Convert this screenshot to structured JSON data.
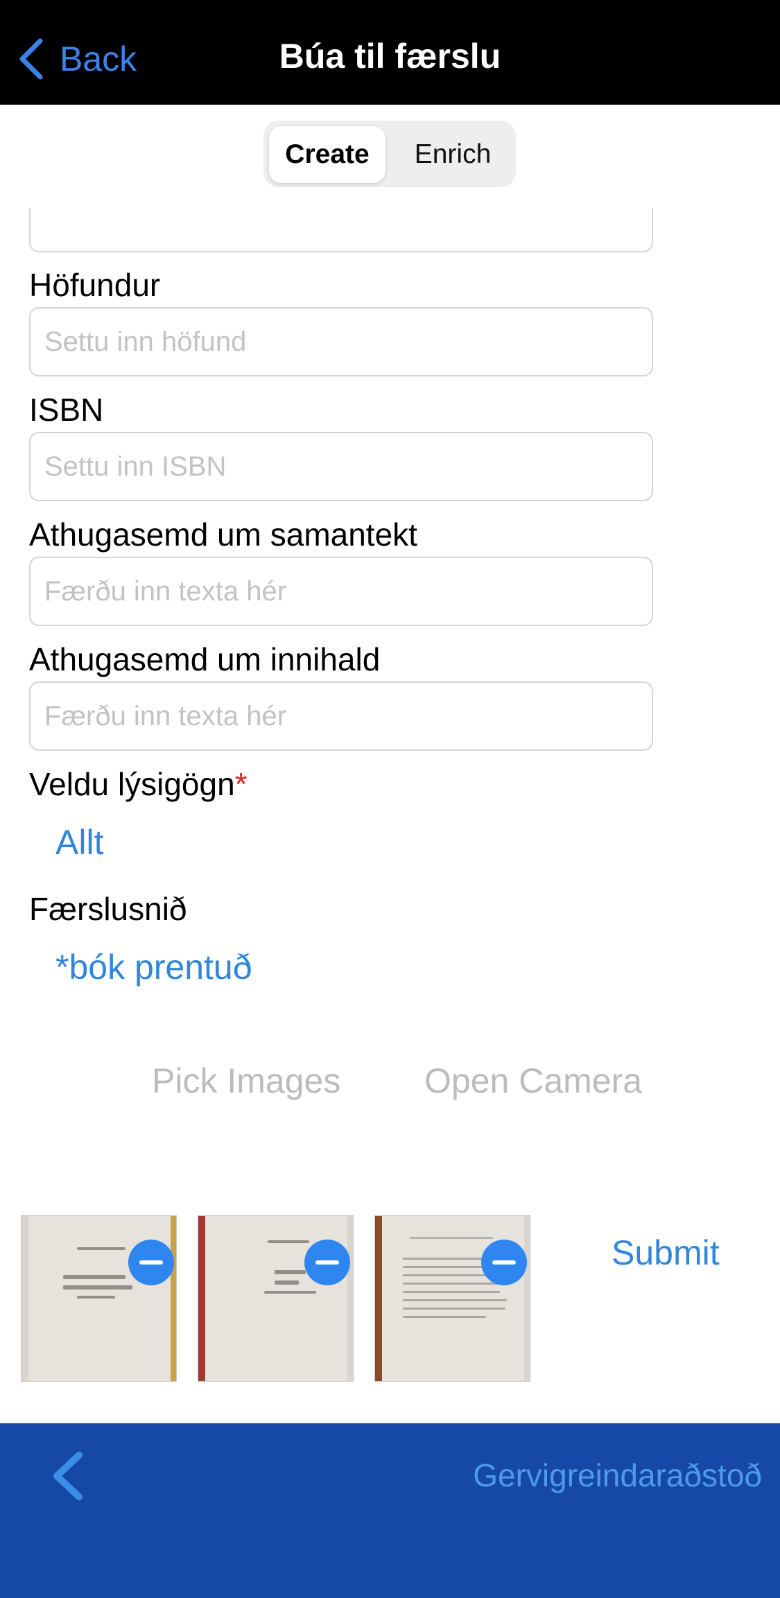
{
  "navbar": {
    "back_label": "Back",
    "title": "Búa til færslu"
  },
  "segmented": {
    "options": [
      "Create",
      "Enrich"
    ],
    "selected": "Create"
  },
  "fields": [
    {
      "label": "Höfundur",
      "placeholder": "Settu inn höfund",
      "value": ""
    },
    {
      "label": "ISBN",
      "placeholder": "Settu inn ISBN",
      "value": ""
    },
    {
      "label": "Athugasemd um samantekt",
      "placeholder": "Færðu inn texta hér",
      "value": ""
    },
    {
      "label": "Athugasemd um innihald",
      "placeholder": "Færðu inn texta hér",
      "value": ""
    }
  ],
  "metadata": {
    "label": "Veldu lýsigögn",
    "required_mark": "*",
    "value": "Allt"
  },
  "record_format": {
    "label": "Færslusnið",
    "value": "*bók prentuð"
  },
  "actions": {
    "pick_images": "Pick Images",
    "open_camera": "Open Camera",
    "submit": "Submit"
  },
  "images": [
    {
      "icon": "book-page-thumbnail"
    },
    {
      "icon": "book-page-thumbnail"
    },
    {
      "icon": "book-page-thumbnail"
    }
  ],
  "bottombar": {
    "assistant_label": "Gervigreindaraðstoð"
  },
  "colors": {
    "accent": "#2f86dc",
    "navbar": "#000000",
    "bottombar": "#1648a8",
    "required": "#e02424"
  }
}
